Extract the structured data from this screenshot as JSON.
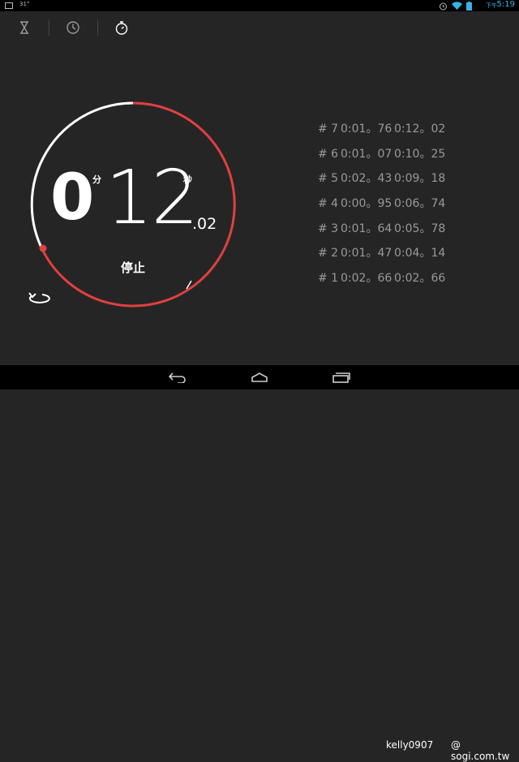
{
  "status_bar": {
    "temperature": "31°",
    "ampm": "下午",
    "time": "5:19",
    "accent": "#33b5e5"
  },
  "tabs": [
    {
      "name": "timer",
      "icon": "hourglass-icon",
      "active": false
    },
    {
      "name": "clock",
      "icon": "clock-icon",
      "active": false
    },
    {
      "name": "stopwatch",
      "icon": "stopwatch-icon",
      "active": true
    }
  ],
  "stopwatch": {
    "minutes": "0",
    "minutes_unit": "分",
    "seconds": "12",
    "seconds_unit": "秒",
    "hundredths": ".02",
    "stop_label": "停止",
    "ring_color": "#e0403f",
    "elapsed_ring_color": "#ffffff"
  },
  "laps": [
    {
      "num": "# 7",
      "lap": "0:01。76",
      "total": "0:12。02"
    },
    {
      "num": "# 6",
      "lap": "0:01。07",
      "total": "0:10。25"
    },
    {
      "num": "# 5",
      "lap": "0:02。43",
      "total": "0:09。18"
    },
    {
      "num": "# 4",
      "lap": "0:00。95",
      "total": "0:06。74"
    },
    {
      "num": "# 3",
      "lap": "0:01。64",
      "total": "0:05。78"
    },
    {
      "num": "# 2",
      "lap": "0:01。47",
      "total": "0:04。14"
    },
    {
      "num": "# 1",
      "lap": "0:02。66",
      "total": "0:02。66"
    }
  ],
  "watermark": {
    "left": "kelly0907",
    "right": "@ sogi.com.tw"
  }
}
